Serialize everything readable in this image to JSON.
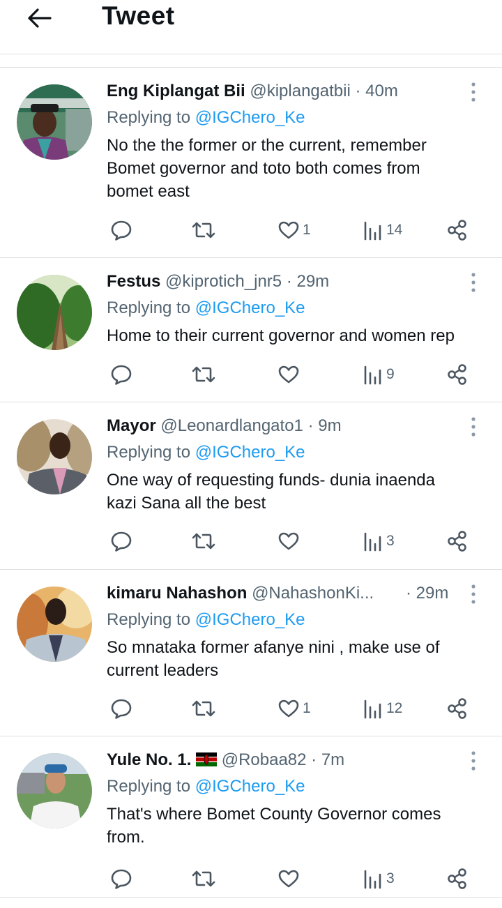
{
  "header": {
    "title": "Tweet"
  },
  "replies": [
    {
      "name": "Eng Kiplangat Bii",
      "handle": "@kiplangatbii",
      "time": "· 40m",
      "replying_label": "Replying to",
      "replying_to": "@IGChero_Ke",
      "text": [
        "No the the former or the current,  remember",
        "Bomet governor and toto both comes from",
        "bomet east"
      ],
      "likes": "1",
      "views": "14"
    },
    {
      "name": "Festus",
      "handle": "@kiprotich_jnr5",
      "time": "· 29m",
      "replying_label": "Replying to",
      "replying_to": "@IGChero_Ke",
      "text": [
        "Home to their current governor and women rep"
      ],
      "likes": "",
      "views": "9"
    },
    {
      "name": "Mayor",
      "handle": "@Leonardlangato1",
      "time": "· 9m",
      "replying_label": "Replying to",
      "replying_to": "@IGChero_Ke",
      "text": [
        "One way of requesting funds- dunia inaenda",
        "kazi Sana all the best"
      ],
      "likes": "",
      "views": "3"
    },
    {
      "name": "kimaru Nahashon",
      "handle": "@NahashonKi...",
      "time": "· 29m",
      "replying_label": "Replying to",
      "replying_to": "@IGChero_Ke",
      "text": [
        "So mnataka former afanye nini , make use of",
        "current leaders"
      ],
      "likes": "1",
      "views": "12"
    },
    {
      "name": "Yule No. 1.",
      "handle": "@Robaa82",
      "time": "· 7m",
      "replying_label": "Replying to",
      "replying_to": "@IGChero_Ke",
      "text": [
        "That's where Bomet County Governor comes",
        "from."
      ],
      "likes": "",
      "views": "3"
    }
  ],
  "colors": {
    "link": "#1d9bf0",
    "muted": "#536471",
    "text": "#0f1419",
    "divider": "#dcdfe2"
  },
  "icons": [
    "back-arrow-icon",
    "more-dots-icon",
    "reply-icon",
    "retweet-icon",
    "like-icon",
    "views-icon",
    "share-icon",
    "kenya-flag-icon"
  ]
}
